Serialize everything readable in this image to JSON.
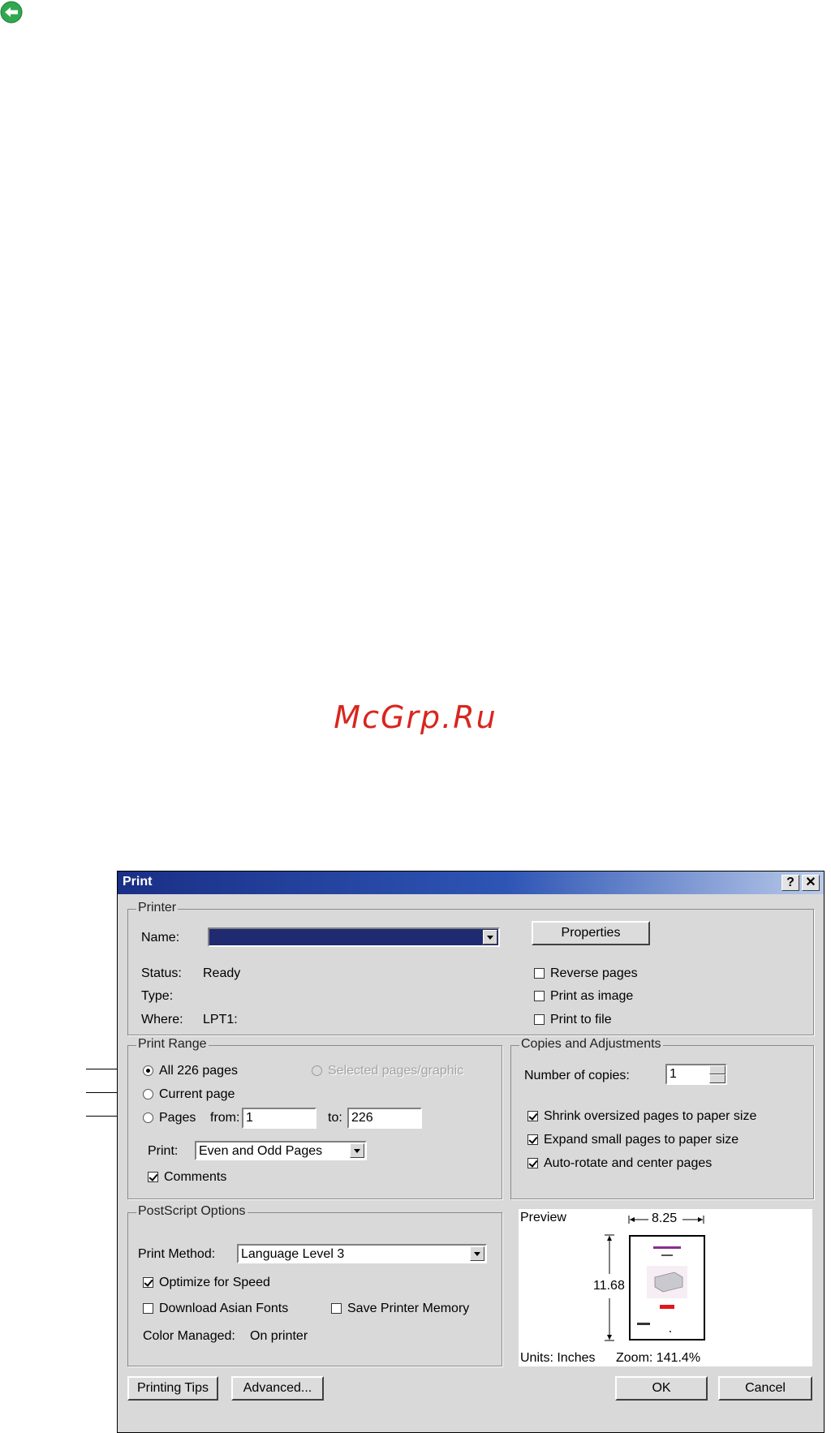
{
  "watermark": "McGrp.Ru",
  "dialog": {
    "title": "Print",
    "help_label": "?",
    "close_label": "✕",
    "printer": {
      "legend": "Printer",
      "name_label": "Name:",
      "name_value": "",
      "properties_label": "Properties",
      "status_label": "Status:",
      "status_value": "Ready",
      "type_label": "Type:",
      "type_value": "",
      "where_label": "Where:",
      "where_value": "LPT1:",
      "reverse_pages": "Reverse pages",
      "print_as_image": "Print as image",
      "print_to_file": "Print to file"
    },
    "range": {
      "legend": "Print Range",
      "all_pages": "All 226 pages",
      "selected": "Selected pages/graphic",
      "current_page": "Current page",
      "pages": "Pages",
      "from_label": "from:",
      "from_value": "1",
      "to_label": "to:",
      "to_value": "226",
      "print_label": "Print:",
      "print_value": "Even and Odd Pages",
      "comments": "Comments"
    },
    "copies": {
      "legend": "Copies and Adjustments",
      "number_label": "Number of copies:",
      "number_value": "1",
      "shrink": "Shrink oversized pages to paper size",
      "expand": "Expand small pages to paper size",
      "autorotate": "Auto-rotate and center pages"
    },
    "postscript": {
      "legend": "PostScript Options",
      "method_label": "Print Method:",
      "method_value": "Language Level 3",
      "optimize": "Optimize for Speed",
      "download_fonts": "Download Asian Fonts",
      "save_memory": "Save Printer Memory",
      "color_managed_label": "Color Managed:",
      "color_managed_value": "On printer"
    },
    "preview": {
      "title": "Preview",
      "width": "8.25",
      "height": "11.68",
      "units": "Units: Inches",
      "zoom": "Zoom: 141.4%"
    },
    "buttons": {
      "printing_tips": "Printing Tips",
      "advanced": "Advanced...",
      "ok": "OK",
      "cancel": "Cancel"
    }
  }
}
